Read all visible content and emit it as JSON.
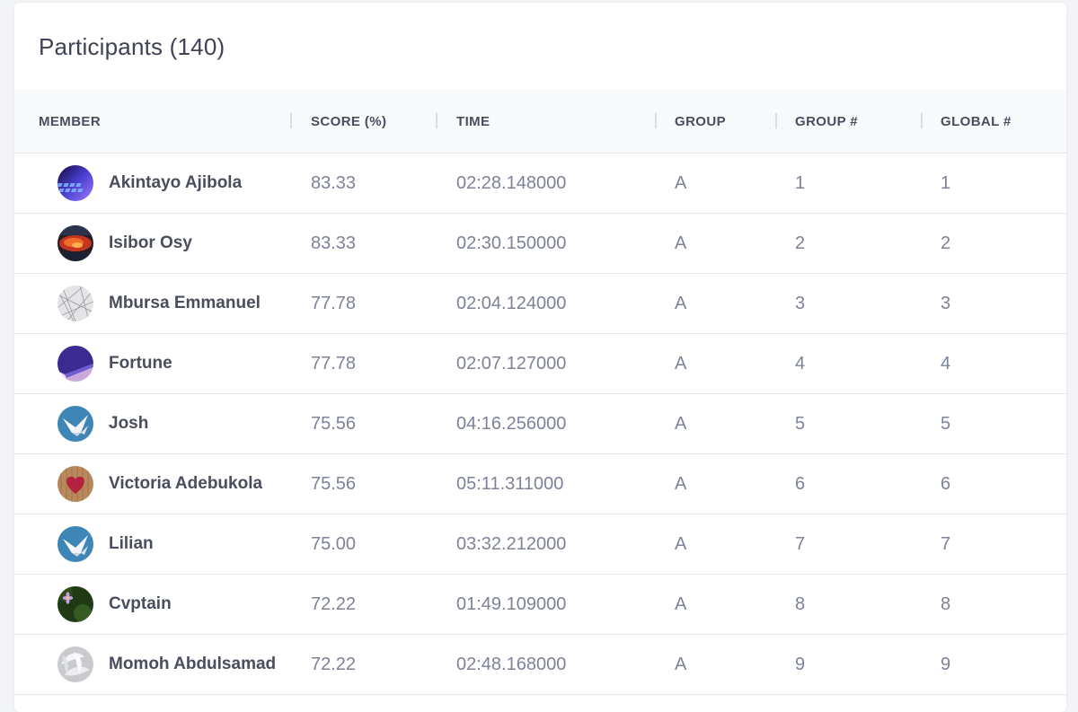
{
  "header": {
    "title": "Participants (140)"
  },
  "columns": {
    "member": "MEMBER",
    "score": "SCORE (%)",
    "time": "TIME",
    "group": "GROUP",
    "group_rank": "GROUP #",
    "global_rank": "GLOBAL #"
  },
  "rows": [
    {
      "name": "Akintayo Ajibola",
      "score": "83.33",
      "time": "02:28.148000",
      "group": "A",
      "group_rank": "1",
      "global_rank": "1",
      "avatar": "keyboard-avatar-icon"
    },
    {
      "name": "Isibor Osy",
      "score": "83.33",
      "time": "02:30.150000",
      "group": "A",
      "group_rank": "2",
      "global_rank": "2",
      "avatar": "fire-avatar-icon"
    },
    {
      "name": "Mbursa Emmanuel",
      "score": "77.78",
      "time": "02:04.124000",
      "group": "A",
      "group_rank": "3",
      "global_rank": "3",
      "avatar": "pattern-avatar-icon"
    },
    {
      "name": "Fortune",
      "score": "77.78",
      "time": "02:07.127000",
      "group": "A",
      "group_rank": "4",
      "global_rank": "4",
      "avatar": "purple-avatar-icon"
    },
    {
      "name": "Josh",
      "score": "75.56",
      "time": "04:16.256000",
      "group": "A",
      "group_rank": "5",
      "global_rank": "5",
      "avatar": "paper-crane-avatar-icon"
    },
    {
      "name": "Victoria Adebukola",
      "score": "75.56",
      "time": "05:11.311000",
      "group": "A",
      "group_rank": "6",
      "global_rank": "6",
      "avatar": "heart-avatar-icon"
    },
    {
      "name": "Lilian",
      "score": "75.00",
      "time": "03:32.212000",
      "group": "A",
      "group_rank": "7",
      "global_rank": "7",
      "avatar": "paper-crane-avatar-icon"
    },
    {
      "name": "Cvptain",
      "score": "72.22",
      "time": "01:49.109000",
      "group": "A",
      "group_rank": "8",
      "global_rank": "8",
      "avatar": "flower-avatar-icon"
    },
    {
      "name": "Momoh Abdulsamad",
      "score": "72.22",
      "time": "02:48.168000",
      "group": "A",
      "group_rank": "9",
      "global_rank": "9",
      "avatar": "white-petals-avatar-icon"
    }
  ]
}
